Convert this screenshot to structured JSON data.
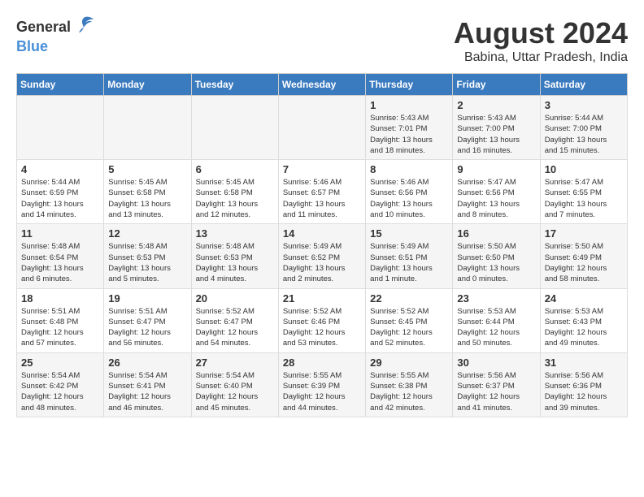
{
  "logo": {
    "general": "General",
    "blue": "Blue"
  },
  "title": {
    "month_year": "August 2024",
    "location": "Babina, Uttar Pradesh, India"
  },
  "headers": [
    "Sunday",
    "Monday",
    "Tuesday",
    "Wednesday",
    "Thursday",
    "Friday",
    "Saturday"
  ],
  "weeks": [
    [
      {
        "day": "",
        "info": ""
      },
      {
        "day": "",
        "info": ""
      },
      {
        "day": "",
        "info": ""
      },
      {
        "day": "",
        "info": ""
      },
      {
        "day": "1",
        "info": "Sunrise: 5:43 AM\nSunset: 7:01 PM\nDaylight: 13 hours\nand 18 minutes."
      },
      {
        "day": "2",
        "info": "Sunrise: 5:43 AM\nSunset: 7:00 PM\nDaylight: 13 hours\nand 16 minutes."
      },
      {
        "day": "3",
        "info": "Sunrise: 5:44 AM\nSunset: 7:00 PM\nDaylight: 13 hours\nand 15 minutes."
      }
    ],
    [
      {
        "day": "4",
        "info": "Sunrise: 5:44 AM\nSunset: 6:59 PM\nDaylight: 13 hours\nand 14 minutes."
      },
      {
        "day": "5",
        "info": "Sunrise: 5:45 AM\nSunset: 6:58 PM\nDaylight: 13 hours\nand 13 minutes."
      },
      {
        "day": "6",
        "info": "Sunrise: 5:45 AM\nSunset: 6:58 PM\nDaylight: 13 hours\nand 12 minutes."
      },
      {
        "day": "7",
        "info": "Sunrise: 5:46 AM\nSunset: 6:57 PM\nDaylight: 13 hours\nand 11 minutes."
      },
      {
        "day": "8",
        "info": "Sunrise: 5:46 AM\nSunset: 6:56 PM\nDaylight: 13 hours\nand 10 minutes."
      },
      {
        "day": "9",
        "info": "Sunrise: 5:47 AM\nSunset: 6:56 PM\nDaylight: 13 hours\nand 8 minutes."
      },
      {
        "day": "10",
        "info": "Sunrise: 5:47 AM\nSunset: 6:55 PM\nDaylight: 13 hours\nand 7 minutes."
      }
    ],
    [
      {
        "day": "11",
        "info": "Sunrise: 5:48 AM\nSunset: 6:54 PM\nDaylight: 13 hours\nand 6 minutes."
      },
      {
        "day": "12",
        "info": "Sunrise: 5:48 AM\nSunset: 6:53 PM\nDaylight: 13 hours\nand 5 minutes."
      },
      {
        "day": "13",
        "info": "Sunrise: 5:48 AM\nSunset: 6:53 PM\nDaylight: 13 hours\nand 4 minutes."
      },
      {
        "day": "14",
        "info": "Sunrise: 5:49 AM\nSunset: 6:52 PM\nDaylight: 13 hours\nand 2 minutes."
      },
      {
        "day": "15",
        "info": "Sunrise: 5:49 AM\nSunset: 6:51 PM\nDaylight: 13 hours\nand 1 minute."
      },
      {
        "day": "16",
        "info": "Sunrise: 5:50 AM\nSunset: 6:50 PM\nDaylight: 13 hours\nand 0 minutes."
      },
      {
        "day": "17",
        "info": "Sunrise: 5:50 AM\nSunset: 6:49 PM\nDaylight: 12 hours\nand 58 minutes."
      }
    ],
    [
      {
        "day": "18",
        "info": "Sunrise: 5:51 AM\nSunset: 6:48 PM\nDaylight: 12 hours\nand 57 minutes."
      },
      {
        "day": "19",
        "info": "Sunrise: 5:51 AM\nSunset: 6:47 PM\nDaylight: 12 hours\nand 56 minutes."
      },
      {
        "day": "20",
        "info": "Sunrise: 5:52 AM\nSunset: 6:47 PM\nDaylight: 12 hours\nand 54 minutes."
      },
      {
        "day": "21",
        "info": "Sunrise: 5:52 AM\nSunset: 6:46 PM\nDaylight: 12 hours\nand 53 minutes."
      },
      {
        "day": "22",
        "info": "Sunrise: 5:52 AM\nSunset: 6:45 PM\nDaylight: 12 hours\nand 52 minutes."
      },
      {
        "day": "23",
        "info": "Sunrise: 5:53 AM\nSunset: 6:44 PM\nDaylight: 12 hours\nand 50 minutes."
      },
      {
        "day": "24",
        "info": "Sunrise: 5:53 AM\nSunset: 6:43 PM\nDaylight: 12 hours\nand 49 minutes."
      }
    ],
    [
      {
        "day": "25",
        "info": "Sunrise: 5:54 AM\nSunset: 6:42 PM\nDaylight: 12 hours\nand 48 minutes."
      },
      {
        "day": "26",
        "info": "Sunrise: 5:54 AM\nSunset: 6:41 PM\nDaylight: 12 hours\nand 46 minutes."
      },
      {
        "day": "27",
        "info": "Sunrise: 5:54 AM\nSunset: 6:40 PM\nDaylight: 12 hours\nand 45 minutes."
      },
      {
        "day": "28",
        "info": "Sunrise: 5:55 AM\nSunset: 6:39 PM\nDaylight: 12 hours\nand 44 minutes."
      },
      {
        "day": "29",
        "info": "Sunrise: 5:55 AM\nSunset: 6:38 PM\nDaylight: 12 hours\nand 42 minutes."
      },
      {
        "day": "30",
        "info": "Sunrise: 5:56 AM\nSunset: 6:37 PM\nDaylight: 12 hours\nand 41 minutes."
      },
      {
        "day": "31",
        "info": "Sunrise: 5:56 AM\nSunset: 6:36 PM\nDaylight: 12 hours\nand 39 minutes."
      }
    ]
  ]
}
